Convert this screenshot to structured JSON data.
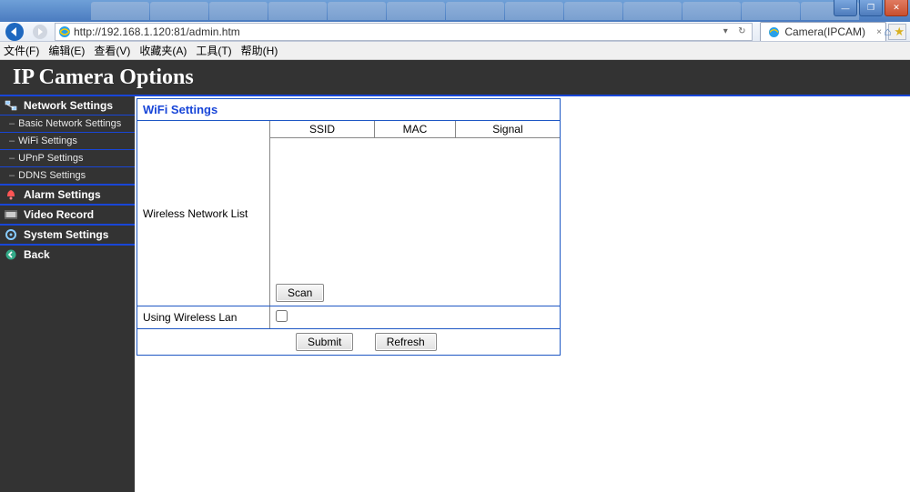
{
  "browser": {
    "url": "http://192.168.1.120:81/admin.htm",
    "tab_title": "Camera(IPCAM)",
    "menus": [
      "文件(F)",
      "编辑(E)",
      "查看(V)",
      "收藏夹(A)",
      "工具(T)",
      "帮助(H)"
    ]
  },
  "header": {
    "title": "IP Camera Options"
  },
  "sidebar": {
    "groups": [
      {
        "label": "Network Settings",
        "icon": "network",
        "items": [
          "Basic Network Settings",
          "WiFi Settings",
          "UPnP Settings",
          "DDNS Settings"
        ]
      },
      {
        "label": "Alarm Settings",
        "icon": "bell",
        "items": []
      },
      {
        "label": "Video Record",
        "icon": "film",
        "items": []
      },
      {
        "label": "System Settings",
        "icon": "gear",
        "items": []
      },
      {
        "label": "Back",
        "icon": "back",
        "items": []
      }
    ]
  },
  "panel": {
    "title": "WiFi Settings",
    "list_label": "Wireless Network List",
    "cols": {
      "ssid": "SSID",
      "mac": "MAC",
      "signal": "Signal"
    },
    "scan_btn": "Scan",
    "use_wlan_label": "Using Wireless Lan",
    "use_wlan_checked": false,
    "submit_btn": "Submit",
    "refresh_btn": "Refresh"
  }
}
